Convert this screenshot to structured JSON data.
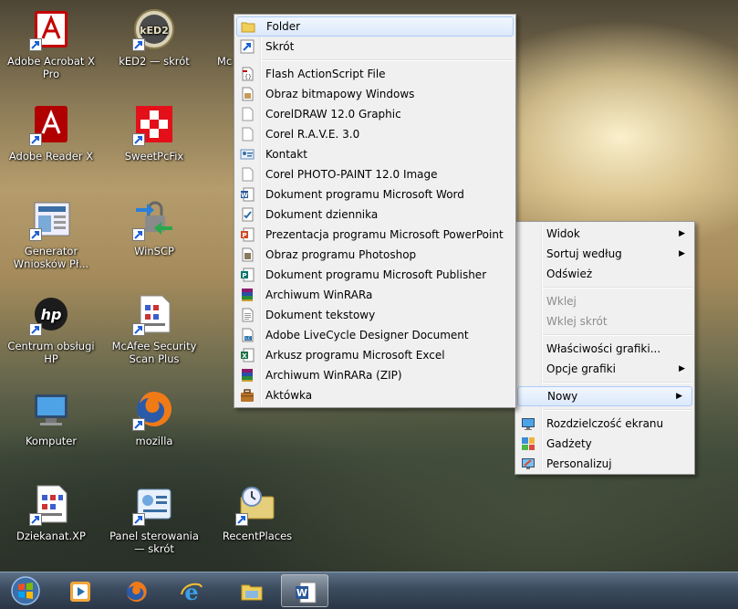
{
  "desktop_icons": {
    "acrobat_pro": "Adobe Acrobat X Pro",
    "ked2": "kED2 — skrót",
    "partial_mc": "Mc",
    "reader": "Adobe Reader X",
    "sweetpcfix": "SweetPcFix",
    "generator": "Generator Wniosków Pł...",
    "winscp": "WinSCP",
    "hp": "Centrum obsługi HP",
    "mcafee": "McAfee Security Scan Plus",
    "computer": "Komputer",
    "mozilla": "mozilla",
    "dziekanat": "Dziekanat.XP",
    "panel": "Panel sterowania — skrót",
    "recent": "RecentPlaces"
  },
  "context_menu": {
    "items": [
      {
        "label": "Widok",
        "submenu": true
      },
      {
        "label": "Sortuj według",
        "submenu": true
      },
      {
        "label": "Odśwież"
      },
      {
        "label": "Wklej",
        "disabled": true
      },
      {
        "label": "Wklej skrót",
        "disabled": true
      },
      {
        "label": "Właściwości grafiki..."
      },
      {
        "label": "Opcje grafiki",
        "submenu": true
      },
      {
        "label": "Nowy",
        "submenu": true,
        "highlighted": true
      },
      {
        "label": "Rozdzielczość ekranu",
        "icon": "monitor-icon"
      },
      {
        "label": "Gadżety",
        "icon": "gadgets-icon"
      },
      {
        "label": "Personalizuj",
        "icon": "personalize-icon"
      }
    ]
  },
  "new_submenu": {
    "items": [
      {
        "label": "Folder",
        "icon": "folder-icon",
        "highlighted": true
      },
      {
        "label": "Skrót",
        "icon": "shortcut-icon"
      },
      {
        "label": "Flash ActionScript File",
        "icon": "flash-file-icon"
      },
      {
        "label": "Obraz bitmapowy Windows",
        "icon": "bitmap-icon"
      },
      {
        "label": "CorelDRAW 12.0 Graphic",
        "icon": "blank-file-icon"
      },
      {
        "label": "Corel R.A.V.E. 3.0",
        "icon": "blank-file-icon"
      },
      {
        "label": "Kontakt",
        "icon": "contact-icon"
      },
      {
        "label": "Corel PHOTO-PAINT 12.0 Image",
        "icon": "blank-file-icon"
      },
      {
        "label": "Dokument programu Microsoft Word",
        "icon": "word-doc-icon"
      },
      {
        "label": "Dokument dziennika",
        "icon": "journal-icon"
      },
      {
        "label": "Prezentacja programu Microsoft PowerPoint",
        "icon": "powerpoint-icon"
      },
      {
        "label": "Obraz programu Photoshop",
        "icon": "photoshop-icon"
      },
      {
        "label": "Dokument programu Microsoft Publisher",
        "icon": "publisher-icon"
      },
      {
        "label": "Archiwum WinRARa",
        "icon": "winrar-icon"
      },
      {
        "label": "Dokument tekstowy",
        "icon": "text-file-icon"
      },
      {
        "label": "Adobe LiveCycle Designer Document",
        "icon": "livecycle-icon"
      },
      {
        "label": "Arkusz programu Microsoft Excel",
        "icon": "excel-icon"
      },
      {
        "label": "Archiwum WinRARa (ZIP)",
        "icon": "winrar-zip-icon"
      },
      {
        "label": "Aktówka",
        "icon": "briefcase-icon"
      }
    ]
  },
  "taskbar": {
    "items": [
      {
        "name": "start-button"
      },
      {
        "name": "media-player-icon"
      },
      {
        "name": "firefox-icon"
      },
      {
        "name": "internet-explorer-icon"
      },
      {
        "name": "explorer-icon"
      },
      {
        "name": "word-icon",
        "active": true
      }
    ]
  },
  "colors": {
    "menu_bg": "#f0f0f0",
    "highlight_border": "#aaccf6",
    "taskbar": "#3b4b5e"
  }
}
